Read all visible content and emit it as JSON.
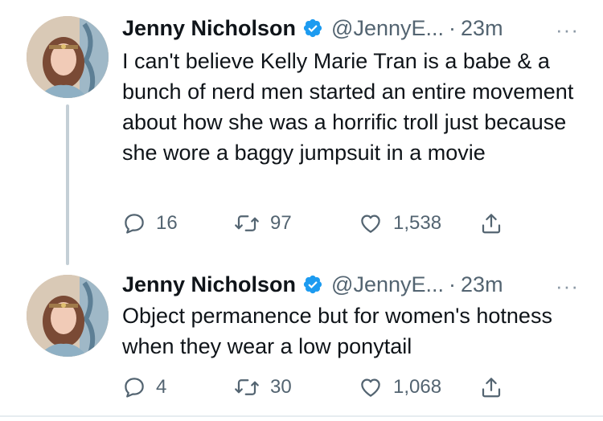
{
  "tweets": [
    {
      "author_name": "Jenny Nicholson",
      "handle": "@JennyE...",
      "separator": "·",
      "time": "23m",
      "more": "···",
      "text": "I can't believe Kelly Marie Tran is a babe & a bunch of nerd men started an entire movement about how she was a horrific troll just because she wore a baggy jumpsuit in a movie",
      "replies": "16",
      "retweets": "97",
      "likes": "1,538"
    },
    {
      "author_name": "Jenny Nicholson",
      "handle": "@JennyE...",
      "separator": "·",
      "time": "23m",
      "more": "···",
      "text": "Object permanence but for women's hotness when they wear a low ponytail",
      "replies": "4",
      "retweets": "30",
      "likes": "1,068"
    }
  ],
  "colors": {
    "verified_blue": "#1d9bf0",
    "secondary_text": "#536471",
    "thread_line": "#c4cfd6"
  },
  "icons": {
    "reply": "reply-icon",
    "retweet": "retweet-icon",
    "like": "like-icon",
    "share": "share-icon",
    "verified": "verified-badge-icon"
  }
}
